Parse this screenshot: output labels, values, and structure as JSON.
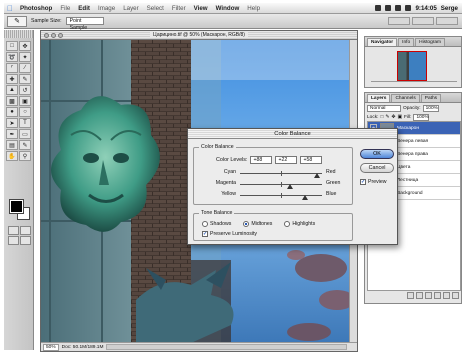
{
  "menubar": {
    "items": [
      "Photoshop",
      "File",
      "Edit",
      "Image",
      "Layer",
      "Select",
      "Filter",
      "View",
      "Window",
      "Help"
    ],
    "clock": "9:14:05",
    "user": "Serge"
  },
  "options": {
    "sample_size_label": "Sample Size:",
    "sample_size_value": "Point Sample"
  },
  "document": {
    "title": "Царицино.tif @ 50% (Маскарон, RGB/8)",
    "zoom": "50%",
    "doc_info": "Doc: 50.1M/189.1M"
  },
  "navigator": {
    "tabs": [
      "Navigator",
      "Info",
      "Histogram"
    ]
  },
  "layers": {
    "tabs": [
      "Layers",
      "Channels",
      "Paths"
    ],
    "blend_mode": "Normal",
    "opacity_label": "Opacity:",
    "opacity": "100%",
    "lock_label": "Lock:",
    "fill_label": "Fill:",
    "fill": "100%",
    "rows": [
      {
        "name": "Маскарон"
      },
      {
        "name": "Венера левая"
      },
      {
        "name": "Венера права"
      },
      {
        "name": "Цвета"
      },
      {
        "name": "Лестница"
      },
      {
        "name": "Background"
      }
    ]
  },
  "dialog": {
    "title": "Color Balance",
    "color_balance_group": "Color Balance",
    "levels_label": "Color Levels:",
    "levels": [
      "+88",
      "+22",
      "+58"
    ],
    "sliders": [
      {
        "left": "Cyan",
        "right": "Red",
        "value": 88
      },
      {
        "left": "Magenta",
        "right": "Green",
        "value": 22
      },
      {
        "left": "Yellow",
        "right": "Blue",
        "value": 58
      }
    ],
    "tone_group": "Tone Balance",
    "tones": [
      "Shadows",
      "Midtones",
      "Highlights"
    ],
    "selected_tone": "Midtones",
    "preserve_luminosity": "Preserve Luminosity",
    "ok": "OK",
    "cancel": "Cancel",
    "preview": "Preview"
  }
}
